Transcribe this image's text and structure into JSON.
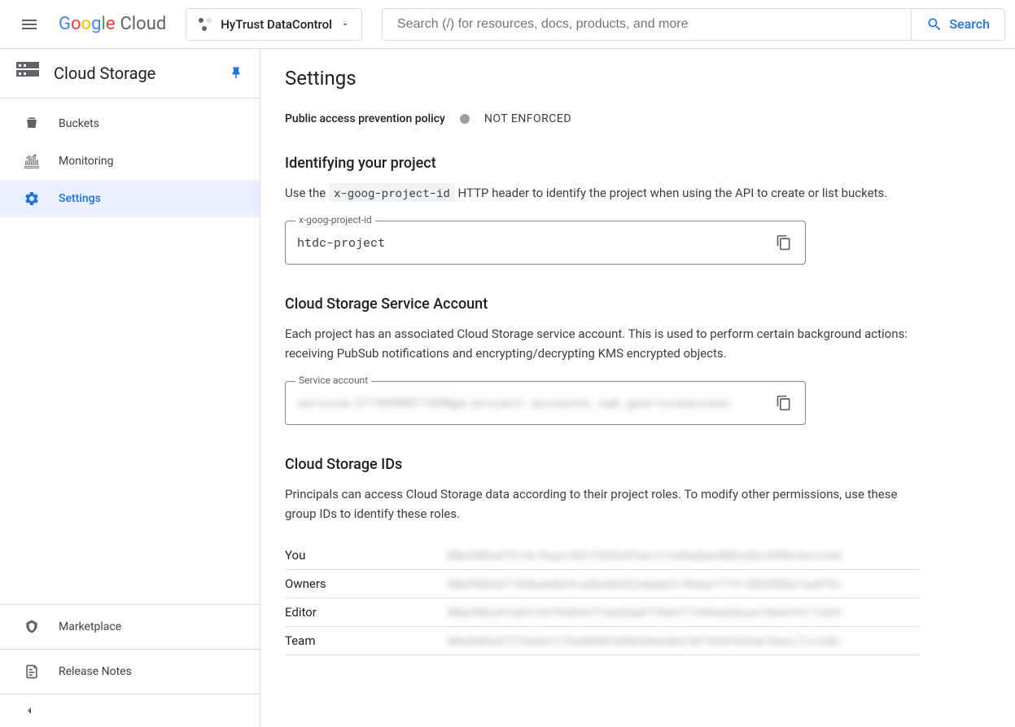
{
  "header": {
    "logo_text": "Google",
    "logo_suffix": "Cloud",
    "project_name": "HyTrust DataControl",
    "search_placeholder": "Search (/) for resources, docs, products, and more",
    "search_button": "Search"
  },
  "sidebar": {
    "service_title": "Cloud Storage",
    "nav": [
      {
        "label": "Buckets",
        "icon": "bucket"
      },
      {
        "label": "Monitoring",
        "icon": "monitoring"
      },
      {
        "label": "Settings",
        "icon": "gear",
        "active": true
      }
    ],
    "bottom": [
      {
        "label": "Marketplace",
        "icon": "marketplace"
      },
      {
        "label": "Release Notes",
        "icon": "notes"
      }
    ]
  },
  "main": {
    "title": "Settings",
    "policy": {
      "label": "Public access prevention policy",
      "status": "NOT ENFORCED"
    },
    "section_identify": {
      "heading": "Identifying your project",
      "desc_pre": "Use the ",
      "desc_code": "x-goog-project-id",
      "desc_post": " HTTP header to identify the project when using the API to create or list buckets.",
      "field_label": "x-goog-project-id",
      "field_value": "htdc-project"
    },
    "section_service": {
      "heading": "Cloud Storage Service Account",
      "desc": "Each project has an associated Cloud Storage service account. This is used to perform certain background actions: receiving PubSub notifications and encrypting/decrypting KMS encrypted objects.",
      "field_label": "Service account",
      "field_value": "service-271839881145@gs-project-accounts.iam.gserviceaccoun"
    },
    "section_ids": {
      "heading": "Cloud Storage IDs",
      "desc": "Principals can access Cloud Storage data according to their project roles. To modify other permissions, use these group IDs to identify these roles.",
      "rows": [
        {
          "role": "You",
          "value": "08b4903a97414c7baa145275265e5fde1313d9e0a64802e2bc3990c9a1a1b9"
        },
        {
          "role": "Owners",
          "value": "00b4903a97764bebdb24ca9ba9b322ababb3156dae7f1613822056a7aa075c"
        },
        {
          "role": "Editor",
          "value": "00b4903a97e891287998347f16a3da0779b4f77389ad28eae79b4475712d29"
        },
        {
          "role": "Team",
          "value": "00b4903a9727beb67c7ba80d0fd3065dbed9e18679207b99ab7bbec7ce1b8c"
        }
      ]
    }
  }
}
